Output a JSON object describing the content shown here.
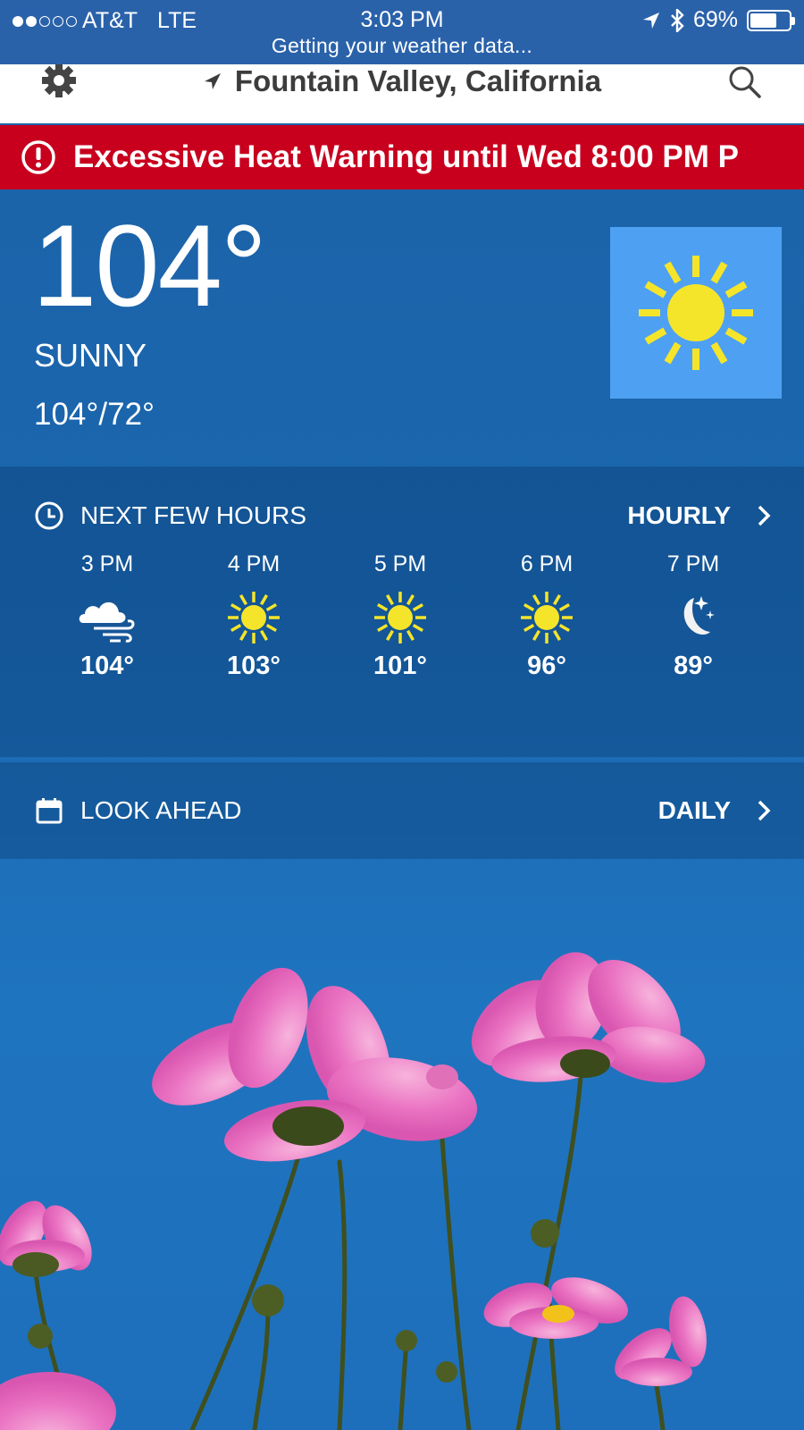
{
  "status_bar": {
    "signal_dots_filled": 2,
    "signal_dots_total": 5,
    "carrier": "AT&T",
    "network": "LTE",
    "time": "3:03 PM",
    "subtitle": "Getting your weather data...",
    "battery": "69%",
    "battery_level": 0.69
  },
  "header": {
    "location": "Fountain Valley, California",
    "icons": [
      "gear-icon",
      "location-arrow-icon",
      "search-icon"
    ]
  },
  "alert": {
    "text": "Excessive Heat Warning until Wed 8:00 PM P",
    "color": "#c8001e"
  },
  "current": {
    "temperature": "104°",
    "condition": "SUNNY",
    "hi_lo": "104°/72°",
    "icon": "sun-icon"
  },
  "next_hours": {
    "title": "NEXT FEW HOURS",
    "link": "HOURLY",
    "hours": [
      {
        "time": "3 PM",
        "icon": "windy-cloud-icon",
        "temp": "104°"
      },
      {
        "time": "4 PM",
        "icon": "sun-icon",
        "temp": "103°"
      },
      {
        "time": "5 PM",
        "icon": "sun-icon",
        "temp": "101°"
      },
      {
        "time": "6 PM",
        "icon": "sun-icon",
        "temp": "96°"
      },
      {
        "time": "7 PM",
        "icon": "moon-icon",
        "temp": "89°"
      }
    ]
  },
  "look_ahead": {
    "title": "LOOK AHEAD",
    "link": "DAILY"
  },
  "colors": {
    "status_bar": "#2a62aa",
    "sun": "#f5e52a",
    "icon_box": "#4ea0f2",
    "alert": "#c8001e"
  }
}
